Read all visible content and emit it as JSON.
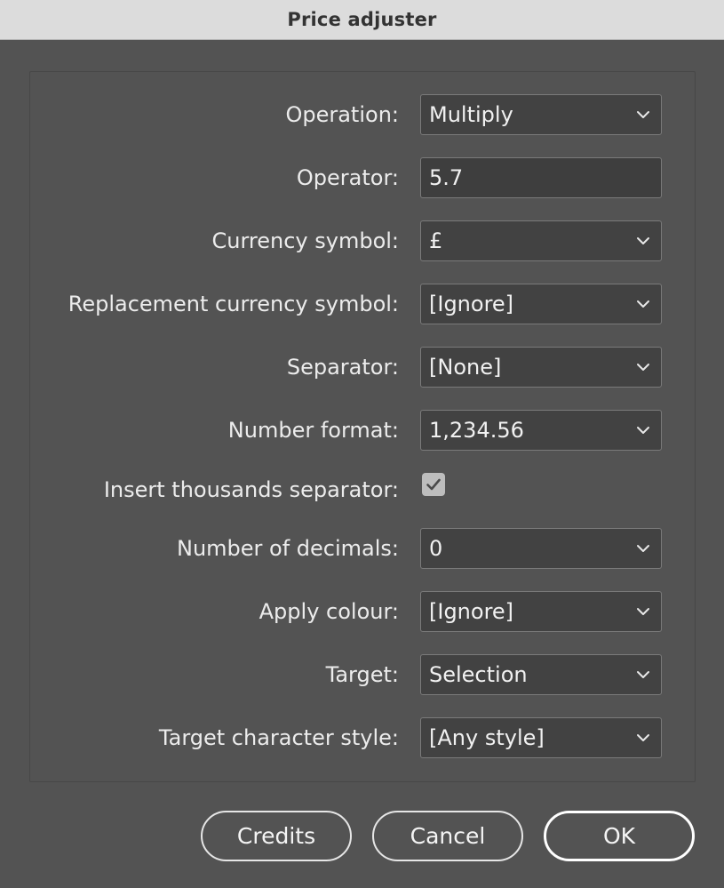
{
  "window": {
    "title": "Price adjuster"
  },
  "form": {
    "operation": {
      "label": "Operation:",
      "value": "Multiply"
    },
    "operator": {
      "label": "Operator:",
      "value": "5.7"
    },
    "currency_symbol": {
      "label": "Currency symbol:",
      "value": "£"
    },
    "replacement_currency_symbol": {
      "label": "Replacement currency symbol:",
      "value": "[Ignore]"
    },
    "separator": {
      "label": "Separator:",
      "value": "[None]"
    },
    "number_format": {
      "label": "Number format:",
      "value": "1,234.56"
    },
    "insert_thousands_separator": {
      "label": "Insert thousands separator:",
      "checked": true
    },
    "number_of_decimals": {
      "label": "Number of decimals:",
      "value": "0"
    },
    "apply_colour": {
      "label": "Apply colour:",
      "value": "[Ignore]"
    },
    "target": {
      "label": "Target:",
      "value": "Selection"
    },
    "target_character_style": {
      "label": "Target character style:",
      "value": "[Any style]"
    }
  },
  "buttons": {
    "credits": "Credits",
    "cancel": "Cancel",
    "ok": "OK"
  },
  "icons": {
    "dropdown": "chevron-down-icon",
    "check": "checkmark-icon"
  },
  "colors": {
    "background": "#535353",
    "titlebar": "#dcdcdc",
    "field": "#3e3e3e",
    "text": "#ececec"
  }
}
